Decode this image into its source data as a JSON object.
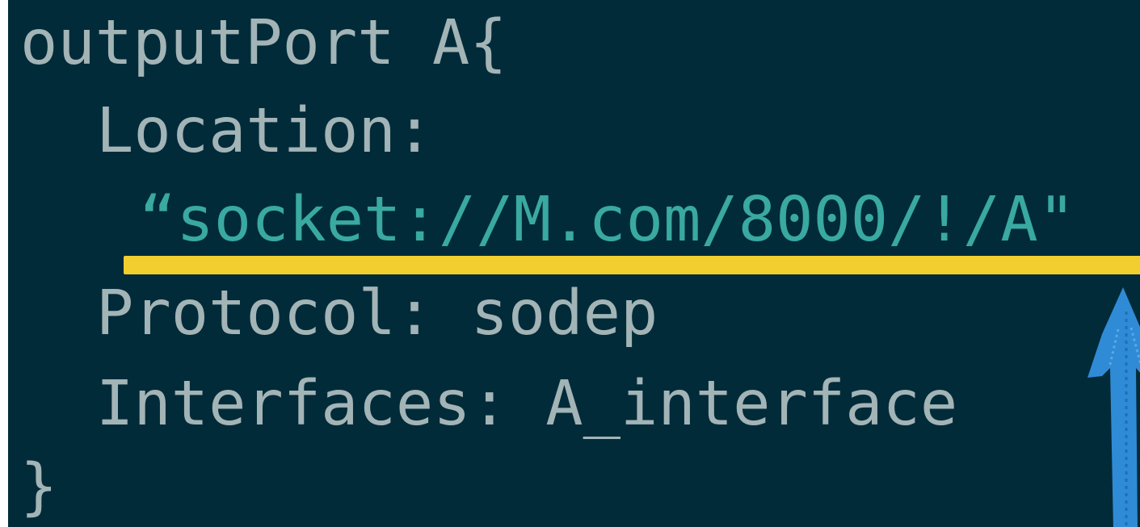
{
  "code": {
    "lines": [
      "outputPort A{",
      "Location:",
      "“socket://M.com/8000/!/A\"",
      "Protocol: sodep",
      "Interfaces: A_interface",
      "}"
    ]
  },
  "colors": {
    "background": "#022b3a",
    "text": "#a3b4b6",
    "string": "#39a9a1",
    "highlight": "#f2cf2f",
    "arrow": "#2f8bd6"
  },
  "annotations": {
    "underline": "highlight-underline",
    "arrow": "up-arrow-icon"
  }
}
